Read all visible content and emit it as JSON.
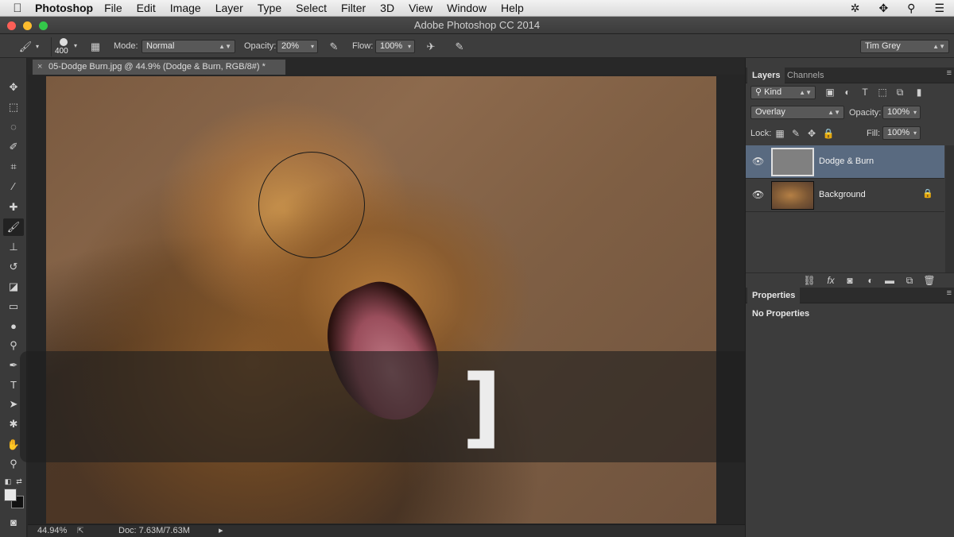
{
  "menubar": {
    "apple": "",
    "app": "Photoshop",
    "items": [
      "File",
      "Edit",
      "Image",
      "Layer",
      "Type",
      "Select",
      "Filter",
      "3D",
      "View",
      "Window",
      "Help"
    ]
  },
  "window": {
    "title": "Adobe Photoshop CC 2014"
  },
  "options": {
    "brush_size": "400",
    "mode_label": "Mode:",
    "mode_value": "Normal",
    "opacity_label": "Opacity:",
    "opacity_value": "20%",
    "flow_label": "Flow:",
    "flow_value": "100%",
    "workspace": "Tim Grey"
  },
  "document": {
    "tab_title": "05-Dodge Burn.jpg @ 44.9% (Dodge & Burn, RGB/8#) *",
    "close": "×"
  },
  "overlay": {
    "key": "]"
  },
  "status": {
    "zoom": "44.94%",
    "doc": "Doc: 7.63M/7.63M",
    "arrow": "▸"
  },
  "layers_panel": {
    "tabs": [
      "Layers",
      "Channels"
    ],
    "filter": "Kind",
    "blend_mode": "Overlay",
    "opacity_label": "Opacity:",
    "opacity_value": "100%",
    "lock_label": "Lock:",
    "fill_label": "Fill:",
    "fill_value": "100%",
    "layers": [
      {
        "name": "Dodge & Burn",
        "selected": true
      },
      {
        "name": "Background",
        "selected": false
      }
    ]
  },
  "properties_panel": {
    "tab": "Properties",
    "message": "No Properties"
  },
  "colors": {
    "selected_layer": "#596a80",
    "panel_bg": "#3c3c3c"
  }
}
